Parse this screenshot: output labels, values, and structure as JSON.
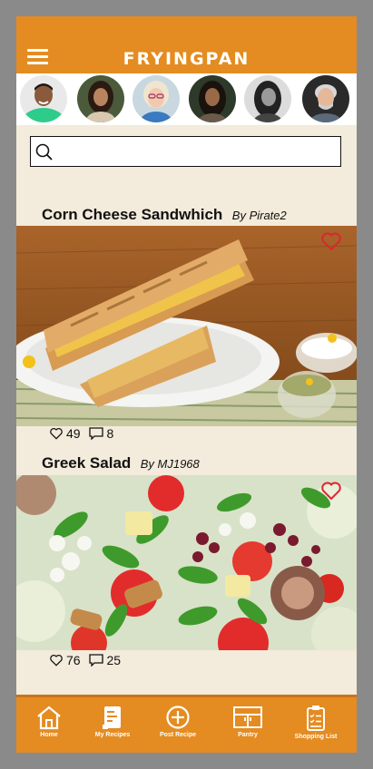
{
  "app": {
    "title": "FRYINGPAN"
  },
  "search": {
    "placeholder": "",
    "value": ""
  },
  "posts": [
    {
      "title": "Corn Cheese Sandwhich",
      "author": "By Pirate2",
      "likes": "49",
      "comments": "8",
      "liked": false
    },
    {
      "title": "Greek Salad",
      "author": "By MJ1968",
      "likes": "76",
      "comments": "25",
      "liked": false
    }
  ],
  "nav": [
    {
      "label": "Home",
      "icon": "home-icon"
    },
    {
      "label": "My Recipes",
      "icon": "recipe-book-icon"
    },
    {
      "label": "Post Recipe",
      "icon": "plus-circle-icon"
    },
    {
      "label": "Pantry",
      "icon": "pantry-cabinet-icon"
    },
    {
      "label": "Shopping List",
      "icon": "clipboard-list-icon"
    }
  ],
  "colors": {
    "brand": "#e48c21",
    "background": "#f3ebdb",
    "heart": "#e0242f"
  }
}
